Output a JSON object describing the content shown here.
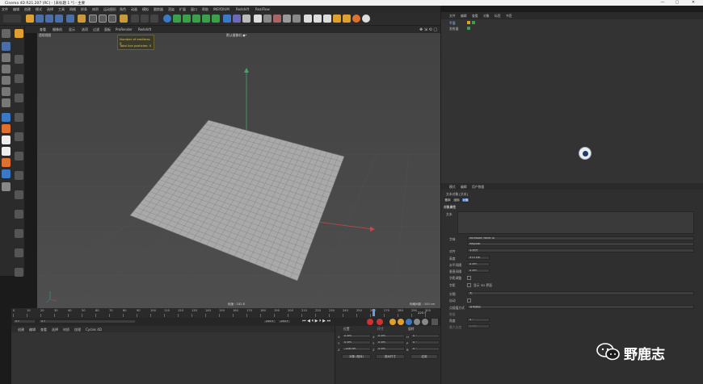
{
  "window": {
    "title": "Cinema 4D R21.207 (RC) - [未标题 1 *] - 主要",
    "controls": [
      "—",
      "▢",
      "✕"
    ]
  },
  "menu": [
    "文件",
    "编辑",
    "创建",
    "模式",
    "选择",
    "工具",
    "网格",
    "样条",
    "体积",
    "运动图形",
    "角色",
    "动画",
    "模拟",
    "跟踪器",
    "渲染",
    "扩展",
    "窗口",
    "帮助",
    "INSYDIUM",
    "Redshift",
    "RealFlow"
  ],
  "viewport": {
    "menu": [
      "查看",
      "摄像机",
      "显示",
      "选项",
      "过滤",
      "面板",
      "ProRender",
      "Redshift"
    ],
    "label": "透视视图",
    "camera": "默认摄像机 ●*",
    "hud": {
      "line1": "Number of emitters: 0",
      "line2": "Total live particles: 0"
    },
    "grid_spacing": "网格间距 : 100 cm",
    "frame_status": "帧速 : 182.8"
  },
  "timeline": {
    "ticks": [
      "0",
      "10",
      "20",
      "30",
      "40",
      "50",
      "60",
      "70",
      "80",
      "90",
      "100",
      "110",
      "120",
      "130",
      "140",
      "150",
      "160",
      "170",
      "180",
      "190",
      "200",
      "210",
      "220",
      "230",
      "240",
      "250",
      "260",
      "270",
      "280",
      "290",
      "300"
    ],
    "current_frame": "225 F",
    "start": "0 F",
    "field2": "0 F",
    "end_a": "250 F",
    "end_b": "250 F"
  },
  "material_menu": [
    "创建",
    "编辑",
    "查看",
    "选择",
    "材质",
    "纹理",
    "Cycles 4D"
  ],
  "coord_panel": {
    "headers": [
      "位置",
      "尺寸",
      "旋转"
    ],
    "rows": [
      {
        "axis": "X",
        "pos": "0 cm",
        "size": "0 cm",
        "rot_label": "H",
        "rot": "0 °"
      },
      {
        "axis": "Y",
        "pos": "0 cm",
        "size": "0 cm",
        "rot_label": "P",
        "rot": "0 °"
      },
      {
        "axis": "Z",
        "pos": "-146 cm",
        "size": "0 cm",
        "rot_label": "B",
        "rot": "0 °"
      }
    ],
    "mode_a": "对象 (相对)",
    "mode_b": "绝对尺寸",
    "apply": "应用"
  },
  "object_manager": {
    "menu": [
      "文件",
      "编辑",
      "查看",
      "对象",
      "标签",
      "书签"
    ],
    "items": [
      {
        "name": "平面",
        "color": "#c9c9c9"
      },
      {
        "name": "发射器",
        "color": "#c9c9c9"
      }
    ]
  },
  "attr_manager": {
    "menu": [
      "模式",
      "编辑",
      "用户数据"
    ],
    "object_title": "文本对象 [文本]",
    "tabs": [
      "基本",
      "坐标",
      "对象"
    ],
    "section": "对象属性",
    "text_label": "文本",
    "font_label": "字体",
    "font_value": "Microsoft YaHei UI",
    "font_style": "Regular",
    "align_label": "对齐",
    "align_value": "中对齐",
    "height_label": "高度",
    "height_value": "975 cm",
    "hspace_label": "水平间隔",
    "hspace_value": "0 cm",
    "vspace_label": "垂直间隔",
    "vspace_value": "0 cm",
    "kerning_label": "字距调整",
    "preview_label": "字距",
    "preview_check": "显示 3D 界面",
    "sep_label": "分隔",
    "sep_value": "无",
    "mirror_label": "自动",
    "pointinterp_label": "点插值方式",
    "pointinterp_value": "自动适应",
    "num_label": "数量",
    "angle_label": "角度",
    "angle_value": "5 °",
    "max_label": "最大长度",
    "max_value": "5 cm"
  },
  "watermark": {
    "text": "野鹿志"
  }
}
